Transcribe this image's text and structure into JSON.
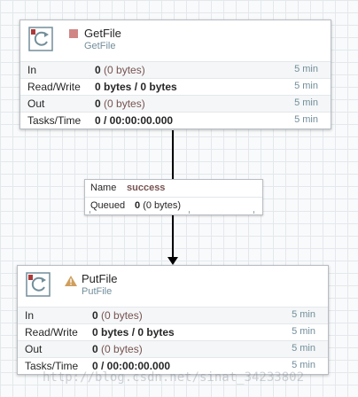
{
  "processors": [
    {
      "name": "GetFile",
      "type": "GetFile",
      "run_status": "stopped",
      "stats": {
        "in": {
          "label": "In",
          "value": "0",
          "detail": "(0 bytes)",
          "time": "5 min"
        },
        "read_write": {
          "label": "Read/Write",
          "value": "0 bytes / 0 bytes",
          "time": "5 min"
        },
        "out": {
          "label": "Out",
          "value": "0",
          "detail": "(0 bytes)",
          "time": "5 min"
        },
        "tasks": {
          "label": "Tasks/Time",
          "value": "0 / 00:00:00.000",
          "time": "5 min"
        }
      }
    },
    {
      "name": "PutFile",
      "type": "PutFile",
      "run_status": "invalid",
      "stats": {
        "in": {
          "label": "In",
          "value": "0",
          "detail": "(0 bytes)",
          "time": "5 min"
        },
        "read_write": {
          "label": "Read/Write",
          "value": "0 bytes / 0 bytes",
          "time": "5 min"
        },
        "out": {
          "label": "Out",
          "value": "0",
          "detail": "(0 bytes)",
          "time": "5 min"
        },
        "tasks": {
          "label": "Tasks/Time",
          "value": "0 / 00:00:00.000",
          "time": "5 min"
        }
      }
    }
  ],
  "connection": {
    "name_label": "Name",
    "name_value": "success",
    "queued_label": "Queued",
    "queued_value": "0",
    "queued_detail": "(0 bytes)"
  },
  "watermark": "http://blog.csdn.net/sinat_34233802",
  "colors": {
    "stopped": "#d18686",
    "invalid": "#cf9f5d",
    "label_value": "#775351",
    "secondary": "#728e9b"
  },
  "icons": [
    "processor-icon",
    "stopped-icon",
    "warning-icon"
  ]
}
